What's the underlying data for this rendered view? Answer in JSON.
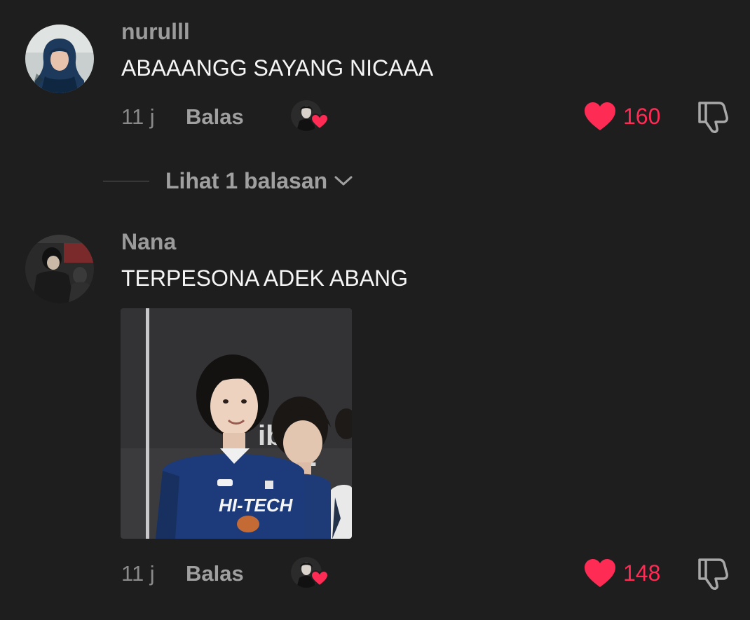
{
  "comments": [
    {
      "username": "nurulll",
      "text": "ABAAANGG SAYANG NICAAA",
      "time": "11 j",
      "reply_label": "Balas",
      "like_count": "160",
      "liked": true
    },
    {
      "username": "Nana",
      "text": "TERPESONA ADEK ABANG",
      "time": "11 j",
      "reply_label": "Balas",
      "like_count": "148",
      "liked": true,
      "image_text": {
        "jersey": "HI-TECH"
      }
    }
  ],
  "view_replies": {
    "label": "Lihat 1 balasan"
  },
  "colors": {
    "background": "#1e1e1e",
    "like": "#fe2c55",
    "username": "#9b9b9b",
    "text": "#f5f5f5"
  },
  "icons": [
    "heart-icon",
    "dislike-icon",
    "chevron-down-icon",
    "creator-like-heart-icon"
  ]
}
